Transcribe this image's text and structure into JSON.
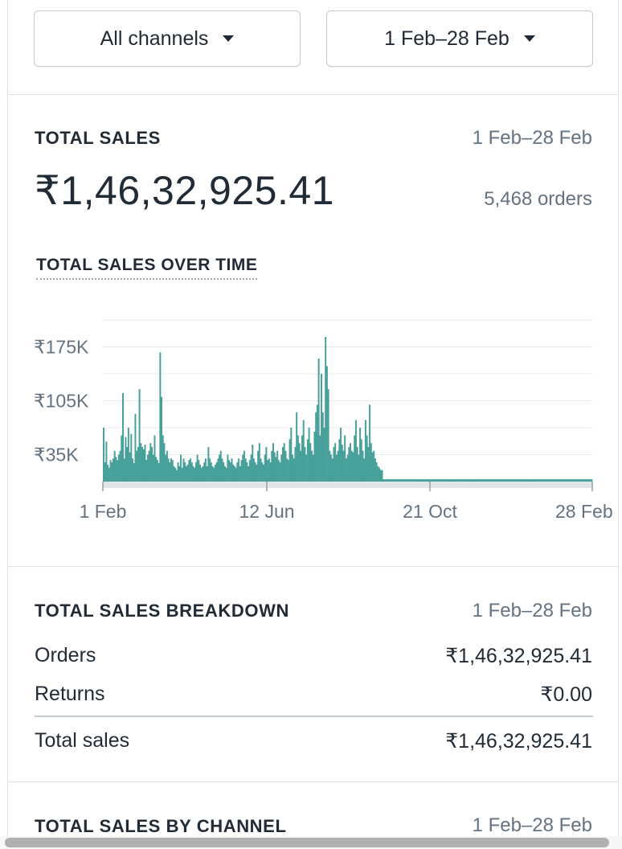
{
  "filters": {
    "channel": "All channels",
    "date_range": "1 Feb–28 Feb"
  },
  "total_sales": {
    "label": "TOTAL SALES",
    "date_range": "1 Feb–28 Feb",
    "amount": "₹1,46,32,925.41",
    "orders": "5,468 orders"
  },
  "chart_section": {
    "title": "TOTAL SALES OVER TIME"
  },
  "chart_data": {
    "type": "bar",
    "title": "TOTAL SALES OVER TIME",
    "y_ticks": [
      "₹175K",
      "₹105K",
      "₹35K"
    ],
    "y_tick_values": [
      175,
      105,
      35
    ],
    "x_ticks": [
      "1 Feb",
      "12 Jun",
      "21 Oct",
      "28 Feb"
    ],
    "ylim": [
      0,
      210
    ],
    "units": "thousands INR",
    "grid": true,
    "color": "#47a09a",
    "series": [
      {
        "values": [
          70,
          25,
          52,
          22,
          18,
          28,
          25,
          30,
          40,
          32,
          28,
          35,
          40,
          60,
          115,
          30,
          58,
          45,
          70,
          38,
          62,
          30,
          24,
          88,
          40,
          45,
          120,
          50,
          45,
          42,
          48,
          28,
          35,
          40,
          50,
          45,
          35,
          60,
          32,
          28,
          24,
          168,
          110,
          60,
          50,
          35,
          40,
          30,
          25,
          30,
          28,
          20,
          18,
          15,
          25,
          20,
          35,
          18,
          30,
          25,
          20,
          22,
          28,
          30,
          25,
          20,
          18,
          25,
          35,
          28,
          22,
          18,
          20,
          25,
          30,
          20,
          45,
          30,
          25,
          20,
          18,
          22,
          25,
          30,
          35,
          40,
          30,
          25,
          20,
          18,
          35,
          28,
          25,
          30,
          22,
          20,
          18,
          25,
          30,
          20,
          28,
          35,
          40,
          30,
          25,
          20,
          28,
          35,
          48,
          30,
          25,
          22,
          40,
          50,
          30,
          25,
          22,
          35,
          45,
          28,
          30,
          25,
          40,
          50,
          38,
          32,
          40,
          28,
          25,
          35,
          45,
          50,
          40,
          30,
          28,
          55,
          70,
          35,
          30,
          45,
          90,
          60,
          50,
          40,
          60,
          80,
          45,
          35,
          55,
          70,
          50,
          40,
          35,
          65,
          90,
          100,
          160,
          60,
          140,
          90,
          70,
          188,
          150,
          120,
          40,
          35,
          30,
          45,
          50,
          35,
          40,
          55,
          70,
          48,
          40,
          60,
          30,
          35,
          45,
          50,
          40,
          38,
          60,
          80,
          45,
          35,
          70,
          55,
          40,
          30,
          80,
          60,
          45,
          100,
          50,
          38,
          40,
          30,
          25,
          20,
          18,
          15,
          15,
          3,
          3,
          3,
          3,
          3,
          3,
          3,
          3,
          3,
          3,
          3,
          3,
          3,
          3,
          3,
          3,
          3,
          3,
          3,
          3,
          3,
          3,
          3,
          3,
          3,
          3,
          3,
          3,
          3,
          3,
          3,
          3,
          3,
          3,
          3,
          3,
          3,
          3,
          3,
          3,
          3,
          3,
          3,
          3,
          3,
          3,
          3,
          3,
          3,
          3,
          3,
          3,
          3,
          3,
          3,
          3,
          3,
          3,
          3,
          3,
          3,
          3,
          3,
          3,
          3,
          3,
          3,
          3,
          3,
          3,
          3,
          3,
          3,
          3,
          3,
          3,
          3,
          3,
          3,
          3,
          3,
          3,
          3,
          3,
          3,
          3,
          3,
          3,
          3,
          3,
          3,
          3,
          3,
          3,
          3,
          3,
          3,
          3,
          3,
          3,
          3,
          3,
          3,
          3,
          3,
          3,
          3,
          3,
          3,
          3,
          3,
          3,
          3,
          3,
          3,
          3,
          3,
          3,
          3,
          3,
          3,
          3,
          3,
          3,
          3,
          3,
          3,
          3,
          3,
          3,
          3,
          3,
          3,
          3,
          3,
          3,
          3,
          3,
          3,
          3,
          3,
          3,
          3,
          3,
          3,
          3,
          3,
          3,
          3,
          3,
          3,
          3
        ]
      }
    ]
  },
  "breakdown": {
    "label": "TOTAL SALES BREAKDOWN",
    "date_range": "1 Feb–28 Feb",
    "rows": [
      {
        "label": "Orders",
        "value": "₹1,46,32,925.41"
      },
      {
        "label": "Returns",
        "value": "₹0.00"
      },
      {
        "label": "Total sales",
        "value": "₹1,46,32,925.41"
      }
    ]
  },
  "by_channel": {
    "label": "TOTAL SALES BY CHANNEL",
    "date_range": "1 Feb–28 Feb"
  }
}
